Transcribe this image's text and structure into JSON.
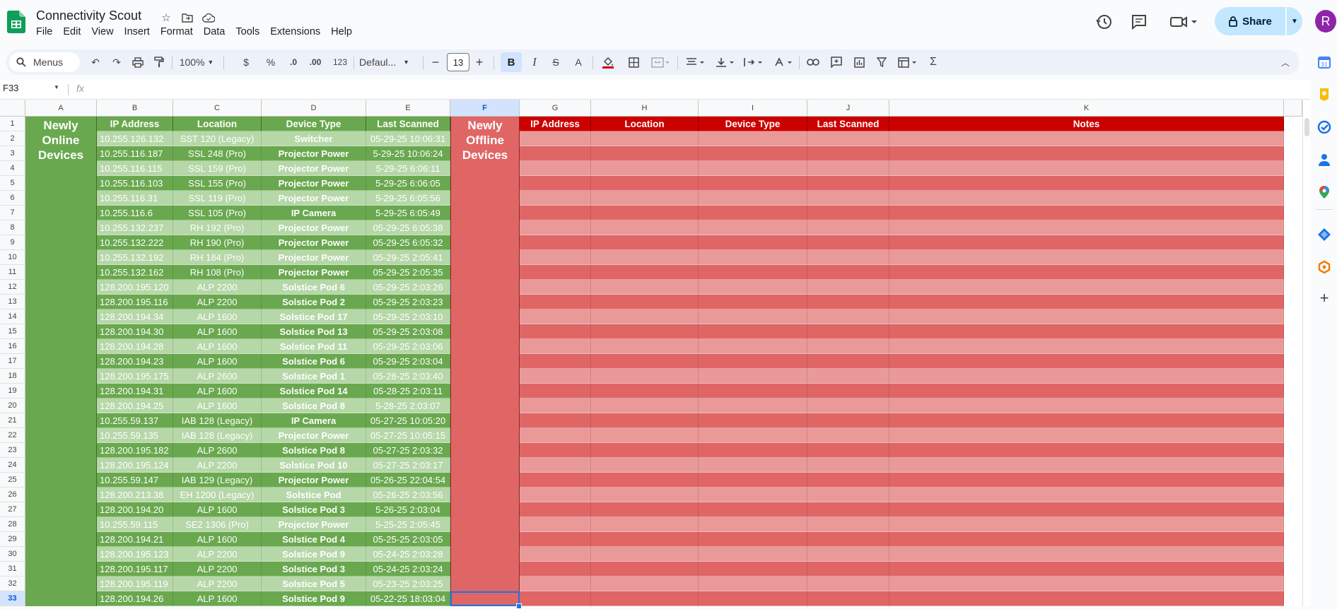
{
  "app": {
    "title": "Connectivity Scout",
    "menu": [
      "File",
      "Edit",
      "View",
      "Insert",
      "Format",
      "Data",
      "Tools",
      "Extensions",
      "Help"
    ],
    "share_label": "Share",
    "avatar_letter": "R"
  },
  "toolbar": {
    "menus_label": "Menus",
    "zoom": "100%",
    "currency": "$",
    "percent": "%",
    "dec_decrease": ".0",
    "dec_increase": ".00",
    "number_format": "123",
    "font": "Defaul...",
    "font_size": "13",
    "bold": "B",
    "italic": "I",
    "text_color": "A",
    "sum": "Σ"
  },
  "formula_bar": {
    "cell_ref": "F33",
    "fx": "fx",
    "value": ""
  },
  "colors": {
    "green_dark": "#6aa84f",
    "green_light": "#b6d7a8",
    "green_header": "#6aa84f",
    "red_dark": "#e06666",
    "red_light": "#ea9999",
    "red_header": "#cc0000"
  },
  "grid": {
    "columns": [
      "A",
      "B",
      "C",
      "D",
      "E",
      "F",
      "G",
      "H",
      "I",
      "J",
      "K"
    ],
    "selected_column": "F",
    "selected_row": "33",
    "online_title": "Newly Online Devices",
    "offline_title": "Newly Offline Devices",
    "online_headers": [
      "IP Address",
      "Location",
      "Device Type",
      "Last Scanned"
    ],
    "offline_headers": [
      "IP Address",
      "Location",
      "Device Type",
      "Last Scanned",
      "Notes"
    ],
    "rows": [
      {
        "n": "2",
        "ip": "10.255.126.132",
        "loc": "SST 120 (Legacy)",
        "type": "Switcher",
        "scan": "05-29-25 10:06:31"
      },
      {
        "n": "3",
        "ip": "10.255.116.187",
        "loc": "SSL 248 (Pro)",
        "type": "Projector Power",
        "scan": "5-29-25 10:06:24"
      },
      {
        "n": "4",
        "ip": "10.255.116.115",
        "loc": "SSL 159 (Pro)",
        "type": "Projector Power",
        "scan": "5-29-25 6:06:11"
      },
      {
        "n": "5",
        "ip": "10.255.116.103",
        "loc": "SSL 155 (Pro)",
        "type": "Projector Power",
        "scan": "5-29-25 6:06:05"
      },
      {
        "n": "6",
        "ip": "10.255.116.31",
        "loc": "SSL 119 (Pro)",
        "type": "Projector Power",
        "scan": "5-29-25 6:05:56"
      },
      {
        "n": "7",
        "ip": "10.255.116.6",
        "loc": "SSL 105 (Pro)",
        "type": "IP Camera",
        "scan": "5-29-25 6:05:49"
      },
      {
        "n": "8",
        "ip": "10.255.132.237",
        "loc": "RH 192 (Pro)",
        "type": "Projector Power",
        "scan": "05-29-25 6:05:38"
      },
      {
        "n": "9",
        "ip": "10.255.132.222",
        "loc": "RH 190 (Pro)",
        "type": "Projector Power",
        "scan": "05-29-25 6:05:32"
      },
      {
        "n": "10",
        "ip": "10.255.132.192",
        "loc": "RH 184 (Pro)",
        "type": "Projector Power",
        "scan": "05-29-25 2:05:41"
      },
      {
        "n": "11",
        "ip": "10.255.132.162",
        "loc": "RH 108 (Pro)",
        "type": "Projector Power",
        "scan": "05-29-25 2:05:35"
      },
      {
        "n": "12",
        "ip": "128.200.195.120",
        "loc": "ALP 2200",
        "type": "Solstice Pod 6",
        "scan": "05-29-25 2:03:26"
      },
      {
        "n": "13",
        "ip": "128.200.195.116",
        "loc": "ALP 2200",
        "type": "Solstice Pod 2",
        "scan": "05-29-25 2:03:23"
      },
      {
        "n": "14",
        "ip": "128.200.194.34",
        "loc": "ALP 1600",
        "type": "Solstice Pod 17",
        "scan": "05-29-25 2:03:10"
      },
      {
        "n": "15",
        "ip": "128.200.194.30",
        "loc": "ALP 1600",
        "type": "Solstice Pod 13",
        "scan": "05-29-25 2:03:08"
      },
      {
        "n": "16",
        "ip": "128.200.194.28",
        "loc": "ALP 1600",
        "type": "Solstice Pod 11",
        "scan": "05-29-25 2:03:06"
      },
      {
        "n": "17",
        "ip": "128.200.194.23",
        "loc": "ALP 1600",
        "type": "Solstice Pod 6",
        "scan": "05-29-25 2:03:04"
      },
      {
        "n": "18",
        "ip": "128.200.195.175",
        "loc": "ALP 2600",
        "type": "Solstice Pod 1",
        "scan": "05-28-25 2:03:40"
      },
      {
        "n": "19",
        "ip": "128.200.194.31",
        "loc": "ALP 1600",
        "type": "Solstice Pod 14",
        "scan": "05-28-25 2:03:11"
      },
      {
        "n": "20",
        "ip": "128.200.194.25",
        "loc": "ALP 1600",
        "type": "Solstice Pod 8",
        "scan": "5-28-25 2:03:07"
      },
      {
        "n": "21",
        "ip": "10.255.59.137",
        "loc": "IAB 128 (Legacy)",
        "type": "IP Camera",
        "scan": "05-27-25 10:05:20"
      },
      {
        "n": "22",
        "ip": "10.255.59.135",
        "loc": "IAB 128 (Legacy)",
        "type": "Projector Power",
        "scan": "05-27-25 10:05:15"
      },
      {
        "n": "23",
        "ip": "128.200.195.182",
        "loc": "ALP 2600",
        "type": "Solstice Pod 8",
        "scan": "05-27-25 2:03:32"
      },
      {
        "n": "24",
        "ip": "128.200.195.124",
        "loc": "ALP 2200",
        "type": "Solstice Pod 10",
        "scan": "05-27-25 2:03:17"
      },
      {
        "n": "25",
        "ip": "10.255.59.147",
        "loc": "IAB 129 (Legacy)",
        "type": "Projector Power",
        "scan": "05-26-25 22:04:54"
      },
      {
        "n": "26",
        "ip": "128.200.213.38",
        "loc": "EH 1200 (Legacy)",
        "type": "Solstice Pod",
        "scan": "05-26-25 2:03:56"
      },
      {
        "n": "27",
        "ip": "128.200.194.20",
        "loc": "ALP 1600",
        "type": "Solstice Pod 3",
        "scan": "5-26-25 2:03:04"
      },
      {
        "n": "28",
        "ip": "10.255.59.115",
        "loc": "SE2 1306 (Pro)",
        "type": "Projector Power",
        "scan": "5-25-25 2:05:45"
      },
      {
        "n": "29",
        "ip": "128.200.194.21",
        "loc": "ALP 1600",
        "type": "Solstice Pod 4",
        "scan": "05-25-25 2:03:05"
      },
      {
        "n": "30",
        "ip": "128.200.195.123",
        "loc": "ALP 2200",
        "type": "Solstice Pod 9",
        "scan": "05-24-25 2:03:28"
      },
      {
        "n": "31",
        "ip": "128.200.195.117",
        "loc": "ALP 2200",
        "type": "Solstice Pod 3",
        "scan": "05-24-25 2:03:24"
      },
      {
        "n": "32",
        "ip": "128.200.195.119",
        "loc": "ALP 2200",
        "type": "Solstice Pod 5",
        "scan": "05-23-25 2:03:25"
      },
      {
        "n": "33",
        "ip": "128.200.194.26",
        "loc": "ALP 1600",
        "type": "Solstice Pod 9",
        "scan": "05-22-25 18:03:04"
      }
    ]
  }
}
